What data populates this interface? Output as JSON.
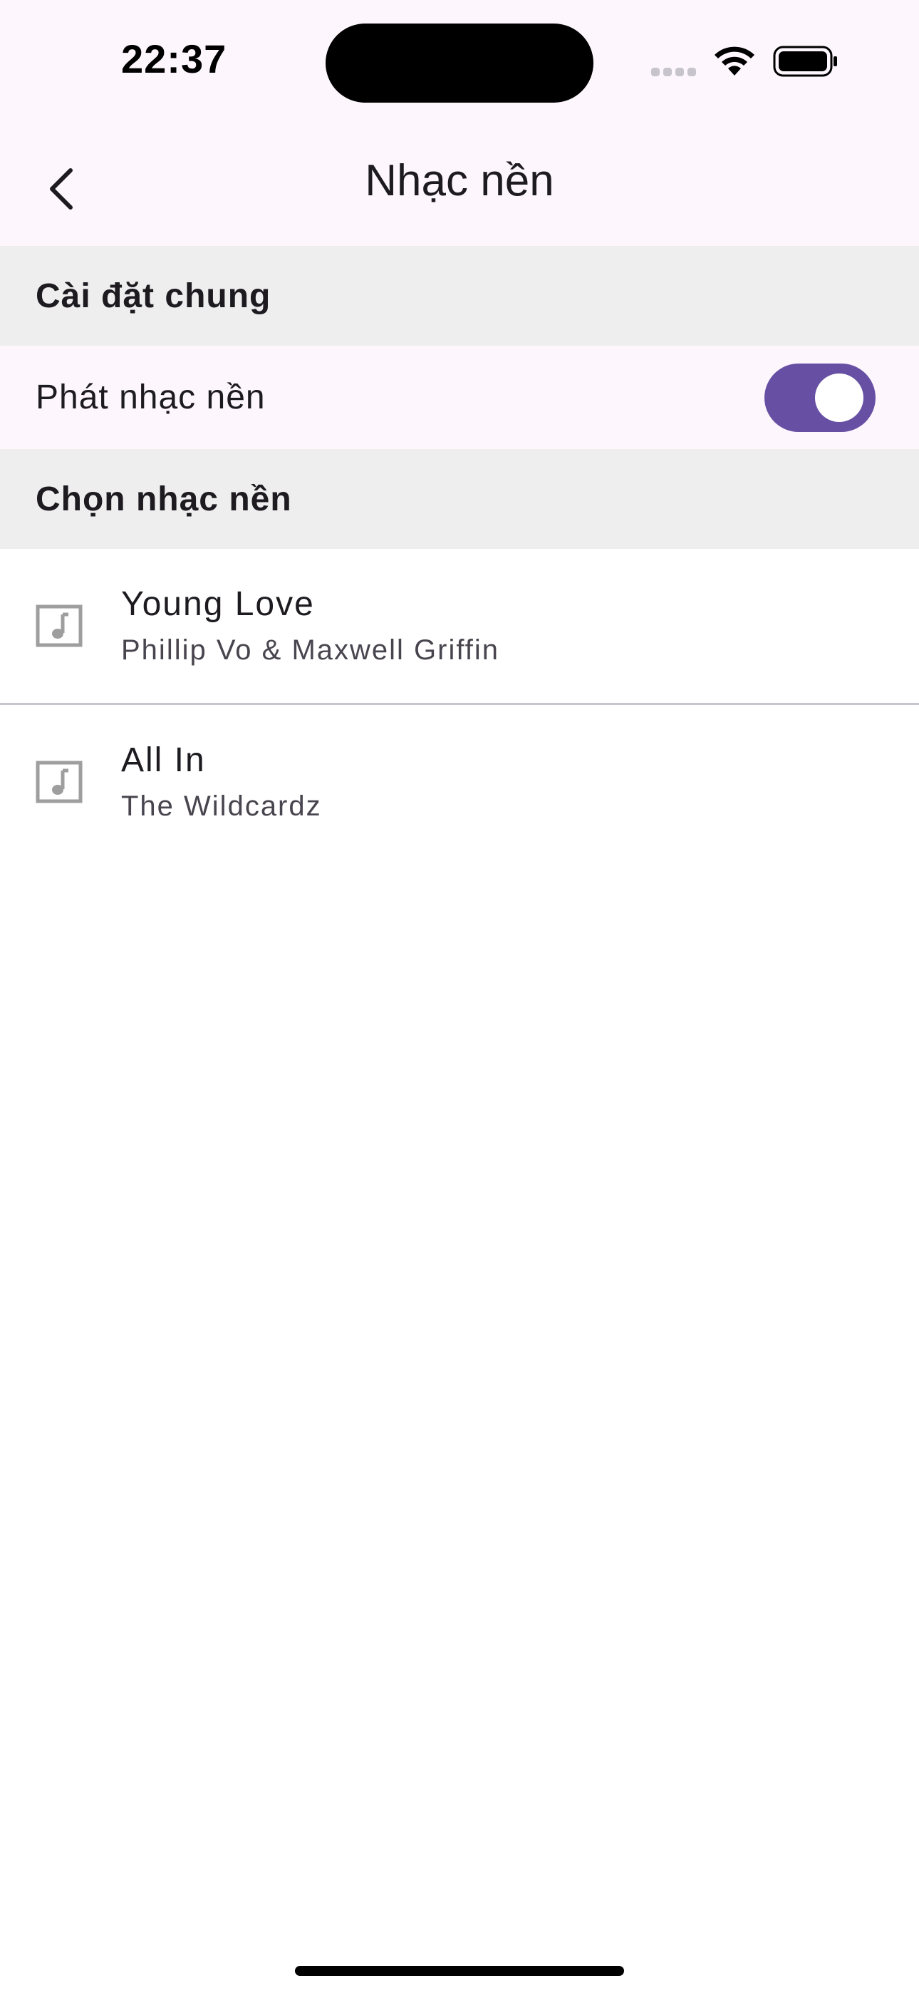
{
  "status_bar": {
    "time": "22:37"
  },
  "header": {
    "title": "Nhạc nền"
  },
  "general_section": {
    "title": "Cài đặt chung",
    "toggle_label": "Phát nhạc nền",
    "toggle_on": true
  },
  "music_section": {
    "title": "Chọn nhạc nền"
  },
  "tracks": [
    {
      "title": "Young Love",
      "artist": "Phillip Vo & Maxwell Griffin",
      "icon": "music-note-icon"
    },
    {
      "title": "All In",
      "artist": "The Wildcardz",
      "icon": "music-note-icon"
    }
  ],
  "colors": {
    "accent": "#6750a4",
    "app_bar_background": "#fdf7fd",
    "section_background": "#eeeeee",
    "icon_gray": "#9e9e9e"
  }
}
